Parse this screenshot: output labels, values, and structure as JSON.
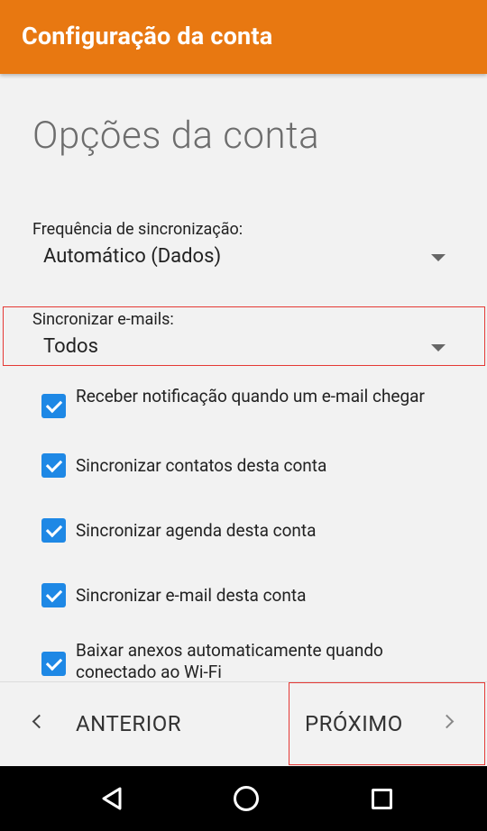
{
  "app_bar": {
    "title": "Configuração da conta"
  },
  "heading": "Opções da conta",
  "sync_frequency": {
    "label": "Frequência de sincronização:",
    "value": "Automático (Dados)"
  },
  "sync_emails": {
    "label": "Sincronizar e-mails:",
    "value": "Todos"
  },
  "options": [
    {
      "label": "Receber notificação quando um e-mail chegar",
      "checked": true
    },
    {
      "label": "Sincronizar contatos desta conta",
      "checked": true
    },
    {
      "label": "Sincronizar agenda desta conta",
      "checked": true
    },
    {
      "label": "Sincronizar e-mail desta conta",
      "checked": true
    },
    {
      "label": "Baixar anexos automaticamente quando conectado ao Wi-Fi",
      "checked": true
    }
  ],
  "bottom_nav": {
    "previous_label": "ANTERIOR",
    "next_label": "PRÓXIMO"
  },
  "system_nav": {
    "back_icon": "back-icon",
    "home_icon": "home-icon",
    "recents_icon": "recents-icon"
  },
  "colors": {
    "app_bar": "#e87811",
    "checkbox": "#1e88e5",
    "highlight": "#e53935"
  }
}
